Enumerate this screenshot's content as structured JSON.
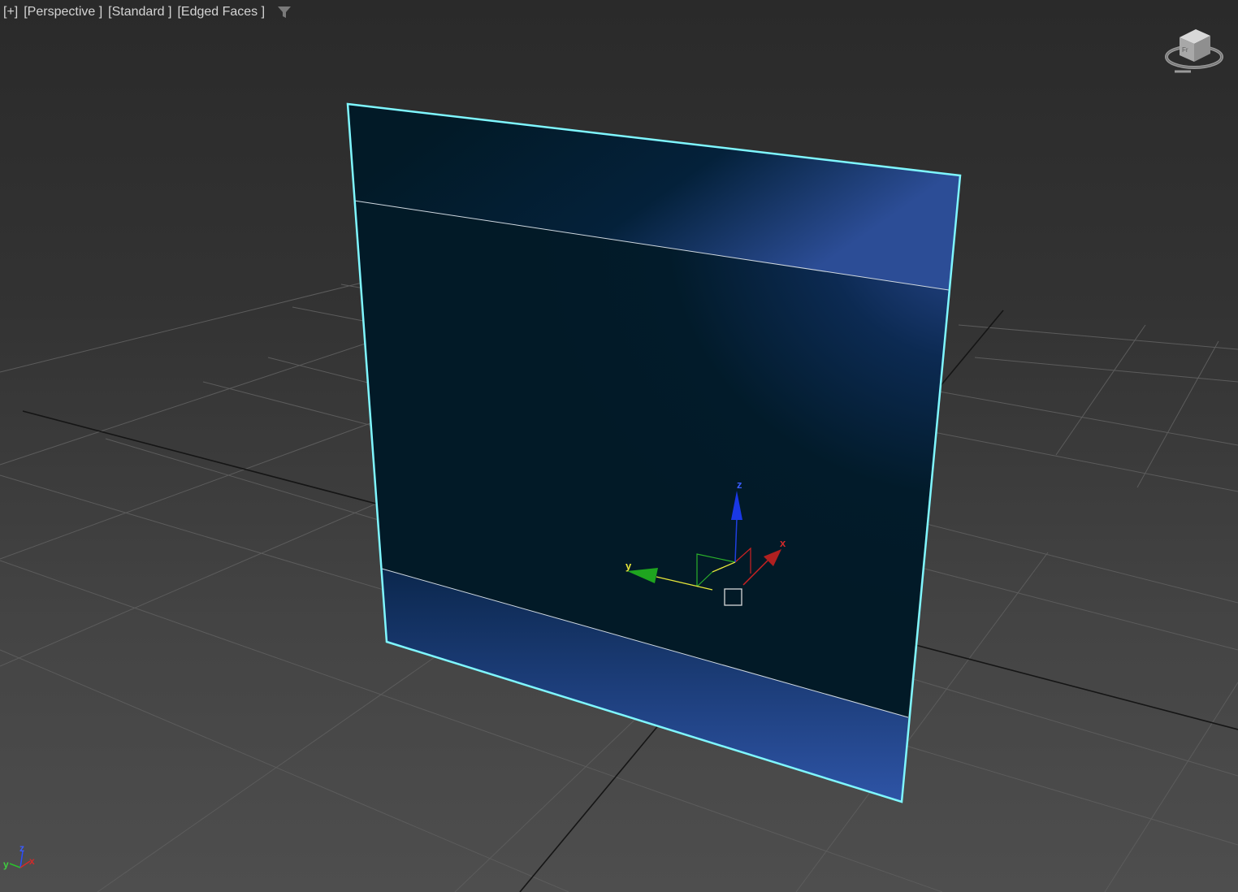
{
  "viewport": {
    "menu_label": "[+]",
    "view_label": "[Perspective ]",
    "shading_label": "[Standard ]",
    "display_label": "[Edged Faces ]",
    "filter_icon": "filter-funnel-icon",
    "viewcube_icon": "viewcube-icon"
  },
  "gizmo": {
    "x_label": "x",
    "y_label": "y",
    "z_label": "z"
  },
  "corner_axes": {
    "x_label": "x",
    "y_label": "y",
    "z_label": "z"
  },
  "colors": {
    "selection_outline": "#7ff7ff",
    "plane_dark": "#021a27",
    "plane_highlight": "#2e4f9c",
    "grid_line": "#5e5e5e",
    "grid_axis": "#111111",
    "axis_x": "#d42828",
    "axis_y": "#22aa22",
    "axis_z": "#1f3fe0"
  }
}
